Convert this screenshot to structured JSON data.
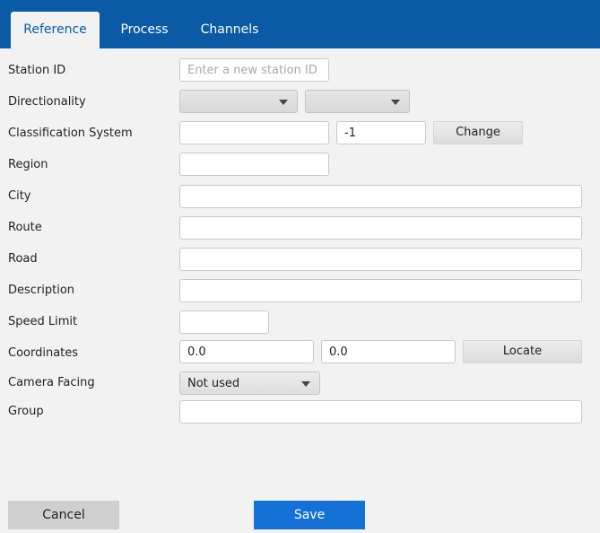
{
  "tabs": [
    {
      "label": "Reference",
      "active": true
    },
    {
      "label": "Process",
      "active": false
    },
    {
      "label": "Channels",
      "active": false
    }
  ],
  "form": {
    "station_id": {
      "label": "Station ID",
      "value": "",
      "placeholder": "Enter a new station ID"
    },
    "directionality": {
      "label": "Directionality",
      "select1": "",
      "select2": ""
    },
    "classification_system": {
      "label": "Classification System",
      "value": "",
      "code": "-1",
      "change_label": "Change"
    },
    "region": {
      "label": "Region",
      "value": ""
    },
    "city": {
      "label": "City",
      "value": ""
    },
    "route": {
      "label": "Route",
      "value": ""
    },
    "road": {
      "label": "Road",
      "value": ""
    },
    "description": {
      "label": "Description",
      "value": ""
    },
    "speed_limit": {
      "label": "Speed Limit",
      "value": ""
    },
    "coordinates": {
      "label": "Coordinates",
      "lat": "0.0",
      "lon": "0.0",
      "locate_label": "Locate"
    },
    "camera_facing": {
      "label": "Camera Facing",
      "value": "Not used"
    },
    "group": {
      "label": "Group",
      "value": ""
    }
  },
  "footer": {
    "cancel_label": "Cancel",
    "save_label": "Save"
  },
  "colors": {
    "accent": "#0a5aa6",
    "save": "#1471d6",
    "background": "#f2f2f2"
  }
}
